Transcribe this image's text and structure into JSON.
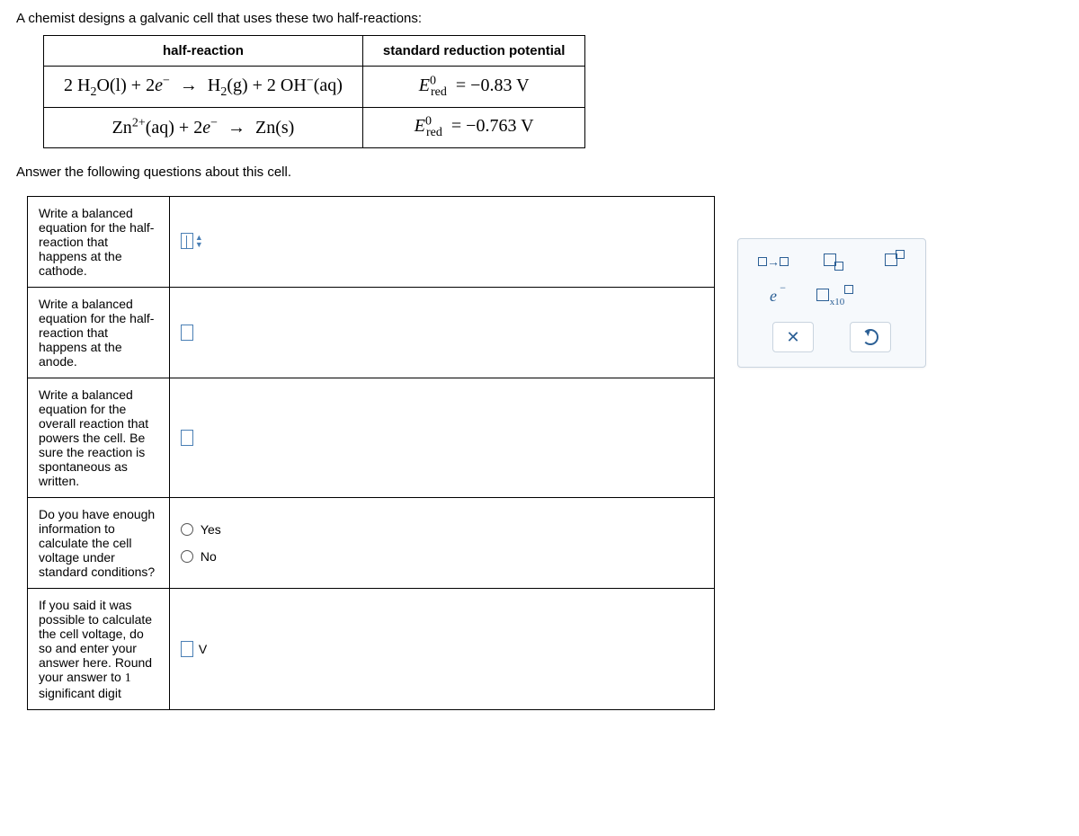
{
  "intro": "A chemist designs a galvanic cell that uses these two half-reactions:",
  "table": {
    "headers": {
      "col1": "half-reaction",
      "col2": "standard reduction potential"
    },
    "row1": {
      "lhs_coef": "2",
      "species1": "H",
      "sub1": "2",
      "species1b": "O(l)",
      "plus": "+",
      "e_coef": "2",
      "e": "e",
      "e_sup": "−",
      "rhs1": "H",
      "rhs1_sub": "2",
      "rhs1_state": "(g)",
      "rhs_plus": "+",
      "oh_coef": "2",
      "oh": "OH",
      "oh_sup": "−",
      "oh_state": "(aq)",
      "pot_symbol": "E",
      "pot_sup": "0",
      "pot_sub": "red",
      "pot_eq": "= −0.83 V"
    },
    "row2": {
      "species": "Zn",
      "charge": "2+",
      "state": "(aq)",
      "plus": "+",
      "e_coef": "2",
      "e": "e",
      "e_sup": "−",
      "rhs": "Zn(s)",
      "pot_symbol": "E",
      "pot_sup": "0",
      "pot_sub": "red",
      "pot_eq": "= −0.763 V"
    }
  },
  "prompt": "Answer the following questions about this cell.",
  "questions": {
    "q1": "Write a balanced equation for the half-reaction that happens at the cathode.",
    "q2": "Write a balanced equation for the half-reaction that happens at the anode.",
    "q3": "Write a balanced equation for the overall reaction that powers the cell. Be sure the reaction is spontaneous as written.",
    "q4": "Do you have enough information to calculate the cell voltage under standard conditions?",
    "q5_a": "If you said it was possible to calculate the cell voltage, do so and enter your answer here. Round your answer to ",
    "q5_num": "1",
    "q5_b": " significant digit"
  },
  "options": {
    "yes": "Yes",
    "no": "No"
  },
  "voltage_unit": "V",
  "palette": {
    "arrow": "→",
    "e_label": "e",
    "x10": "x10",
    "close": "✕"
  }
}
